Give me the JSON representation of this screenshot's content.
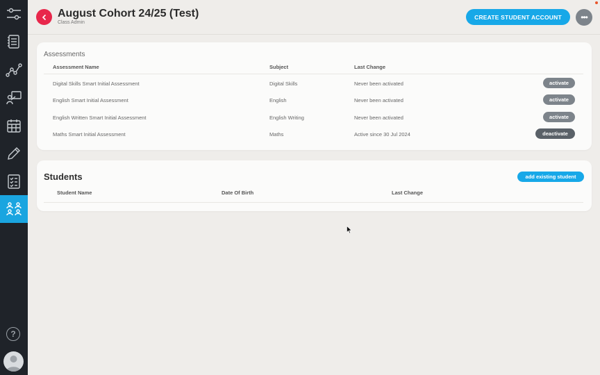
{
  "header": {
    "title": "August Cohort 24/25 (Test)",
    "subtitle": "Class Admin",
    "create_button": "CREATE STUDENT ACCOUNT",
    "more_button": "•••"
  },
  "sidebar": {
    "items": [
      {
        "name": "settings-sliders"
      },
      {
        "name": "notebook"
      },
      {
        "name": "graph"
      },
      {
        "name": "presentation"
      },
      {
        "name": "calendar"
      },
      {
        "name": "pencil"
      },
      {
        "name": "checklist"
      },
      {
        "name": "users",
        "active": true
      }
    ],
    "help": "?"
  },
  "assessments": {
    "title": "Assessments",
    "columns": [
      "Assessment Name",
      "Subject",
      "Last Change"
    ],
    "rows": [
      {
        "name": "Digital Skills Smart Initial Assessment",
        "subject": "Digital Skills",
        "last_change": "Never been activated",
        "action": "activate"
      },
      {
        "name": "English Smart Initial Assessment",
        "subject": "English",
        "last_change": "Never been activated",
        "action": "activate"
      },
      {
        "name": "English Written Smart Initial Assessment",
        "subject": "English Writing",
        "last_change": "Never been activated",
        "action": "activate"
      },
      {
        "name": "Maths Smart Initial Assessment",
        "subject": "Maths",
        "last_change": "Active since 30 Jul 2024",
        "action": "deactivate"
      }
    ]
  },
  "students": {
    "title": "Students",
    "add_button": "add existing student",
    "columns": [
      "Student Name",
      "Date Of Birth",
      "Last Change"
    ]
  },
  "colors": {
    "accent": "#17a8e8",
    "back": "#e8274b",
    "sidebar": "#1f2329",
    "pill": "#7d848b"
  }
}
